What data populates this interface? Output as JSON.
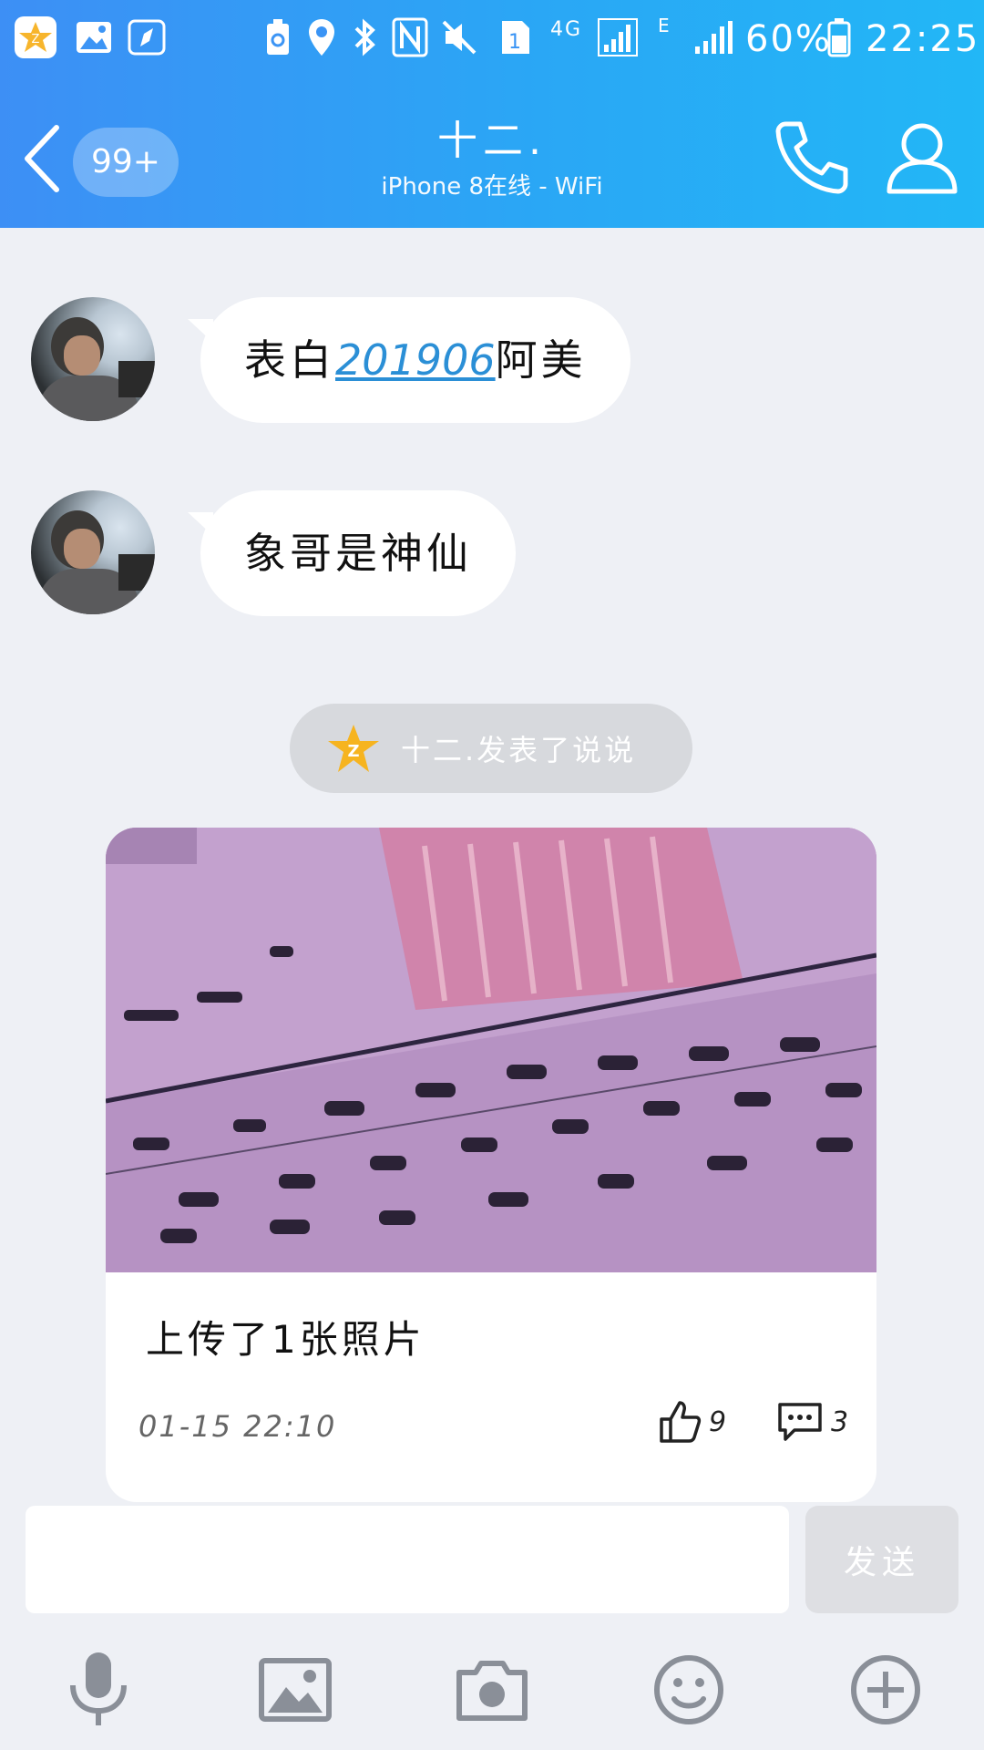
{
  "status_bar": {
    "network": "4G",
    "network_secondary": "E",
    "sim_slot": "1",
    "battery": "60%",
    "time": "22:25"
  },
  "header": {
    "unread_count": "99+",
    "title": "十二.",
    "subtitle": "iPhone 8在线 - WiFi"
  },
  "messages": [
    {
      "prefix": "表白",
      "link": "201906",
      "suffix": "阿美"
    },
    {
      "text": "象哥是神仙"
    }
  ],
  "notification": {
    "text": "十二.发表了说说"
  },
  "feed_card": {
    "caption": "上传了1张照片",
    "timestamp": "01-15  22:10",
    "likes": "9",
    "comments": "3"
  },
  "input": {
    "value": "",
    "placeholder": "",
    "send_label": "发送"
  },
  "colors": {
    "header_start": "#3d8ff5",
    "header_end": "#22b7f6",
    "chat_background": "#eef0f5",
    "link": "#2b8fd6"
  },
  "icons": {
    "status": [
      "qzone-app-icon",
      "gallery-icon",
      "compass-icon",
      "battery-saver-icon",
      "location-icon",
      "bluetooth-icon",
      "nfc-icon",
      "mute-icon",
      "signal-icon",
      "battery-icon"
    ],
    "toolbar": [
      "microphone-icon",
      "image-icon",
      "camera-icon",
      "emoji-icon",
      "plus-icon"
    ]
  }
}
